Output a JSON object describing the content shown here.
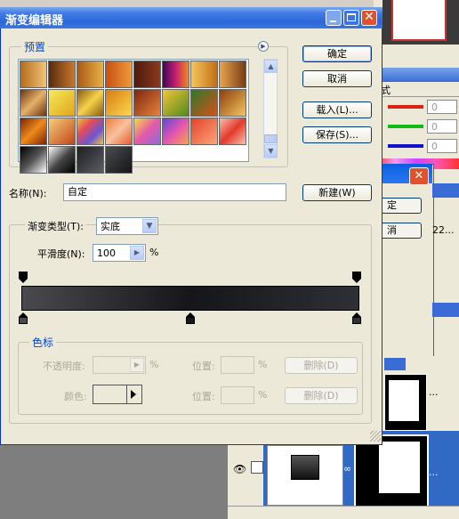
{
  "window": {
    "title": "渐变编辑器"
  },
  "presets": {
    "label": "预置",
    "swatches": [
      {
        "name": "foreground-to-transparent",
        "css": "linear-gradient(90deg,#b46d1a,#f2c27a)"
      },
      {
        "name": "dark-brown",
        "css": "linear-gradient(90deg,#5a2a0c,#c7782d)"
      },
      {
        "name": "copper",
        "css": "linear-gradient(90deg,#a85a12,#e8b04a)"
      },
      {
        "name": "orange-red",
        "css": "linear-gradient(90deg,#c65016,#f09a38)"
      },
      {
        "name": "maroon",
        "css": "linear-gradient(90deg,#4f1a0e,#8a3a1c)"
      },
      {
        "name": "violet-orange",
        "css": "linear-gradient(90deg,#3d0858,#c41d6e,#f08a1e)"
      },
      {
        "name": "yellow-orange",
        "css": "linear-gradient(90deg,#f4c65a,#c46e18)"
      },
      {
        "name": "bronze",
        "css": "linear-gradient(90deg,#e7a550,#7a3c12)"
      },
      {
        "name": "copper-2",
        "css": "linear-gradient(135deg,#6a3512,#e6b06a,#6a3512)"
      },
      {
        "name": "yellow",
        "css": "linear-gradient(135deg,#f6ea5a,#e2a41a)"
      },
      {
        "name": "gold",
        "css": "linear-gradient(135deg,#8a5a10,#f6d24a,#8a5a10)"
      },
      {
        "name": "orange-yellow",
        "css": "linear-gradient(135deg,#d87b12,#fbd84e)"
      },
      {
        "name": "red-copper",
        "css": "linear-gradient(135deg,#7e2410,#e8843a)"
      },
      {
        "name": "green-gold",
        "css": "linear-gradient(135deg,#f2c538,#4f8a1c)"
      },
      {
        "name": "green-red",
        "css": "linear-gradient(135deg,#2b7a2a,#d94f18)"
      },
      {
        "name": "amber",
        "css": "linear-gradient(135deg,#8b3c0c,#f5c662)"
      },
      {
        "name": "orange-strip",
        "css": "linear-gradient(135deg,#7a2406,#f08a1a,#7a2406)"
      },
      {
        "name": "sunset",
        "css": "linear-gradient(135deg,#f6d07a,#c2441a)"
      },
      {
        "name": "rainbow-stripe",
        "css": "linear-gradient(135deg,#f4c23a,#e44a5a,#6b56d4,#f4c23a)"
      },
      {
        "name": "peach",
        "css": "linear-gradient(135deg,#f47b3a,#f9c2a0,#e85a2a)"
      },
      {
        "name": "transparent-rainbow",
        "css": "linear-gradient(135deg,#f6d84a,#e45aa8,#8a6ae0)"
      },
      {
        "name": "violet-pink",
        "css": "linear-gradient(135deg,#5a48d8,#e454b0,#f6a44a)"
      },
      {
        "name": "red-orange",
        "css": "linear-gradient(135deg,#e6402a,#f9a77a)"
      },
      {
        "name": "red-stripe",
        "css": "linear-gradient(135deg,#f6c0b0,#e4392a,#f6c0b0)"
      },
      {
        "name": "black-white",
        "css": "linear-gradient(135deg,#000 0%,#555 50%,#fff 100%)"
      },
      {
        "name": "black-white-2",
        "css": "linear-gradient(135deg,#fff,#444,#000)"
      },
      {
        "name": "dark-steel",
        "css": "linear-gradient(135deg,#1e1f22,#5a5d64)"
      },
      {
        "name": "dark-gradient",
        "css": "linear-gradient(135deg,#4a4c50,#141416)"
      }
    ]
  },
  "buttons": {
    "ok": "确定",
    "cancel": "取消",
    "load": "载入(L)...",
    "save": "保存(S)...",
    "new": "新建(W)",
    "delete_opacity": "删除(D)",
    "delete_color": "删除(D)"
  },
  "name_field": {
    "label": "名称(N):",
    "value": "自定"
  },
  "gradient": {
    "type_label": "渐变类型(T):",
    "type_value": "实底",
    "smoothness_label": "平滑度(N):",
    "smoothness_value": "100",
    "smoothness_unit": "%",
    "colors": [
      "#4a4a4e",
      "#161618",
      "#2e3034"
    ]
  },
  "stops": {
    "group_label": "色标",
    "opacity_label": "不透明度:",
    "opacity_unit": "%",
    "location_label_1": "位置:",
    "location_unit_1": "%",
    "color_label": "颜色:",
    "location_label_2": "位置:",
    "location_unit_2": "%"
  },
  "background_app": {
    "tab_label": "式",
    "slider_values": [
      "0",
      "0",
      "0"
    ],
    "small_dialog": {
      "button_1": "定",
      "button_2": "消",
      "number": "22..."
    },
    "layer_dots_1": "...",
    "layer_dots_2": "..."
  }
}
